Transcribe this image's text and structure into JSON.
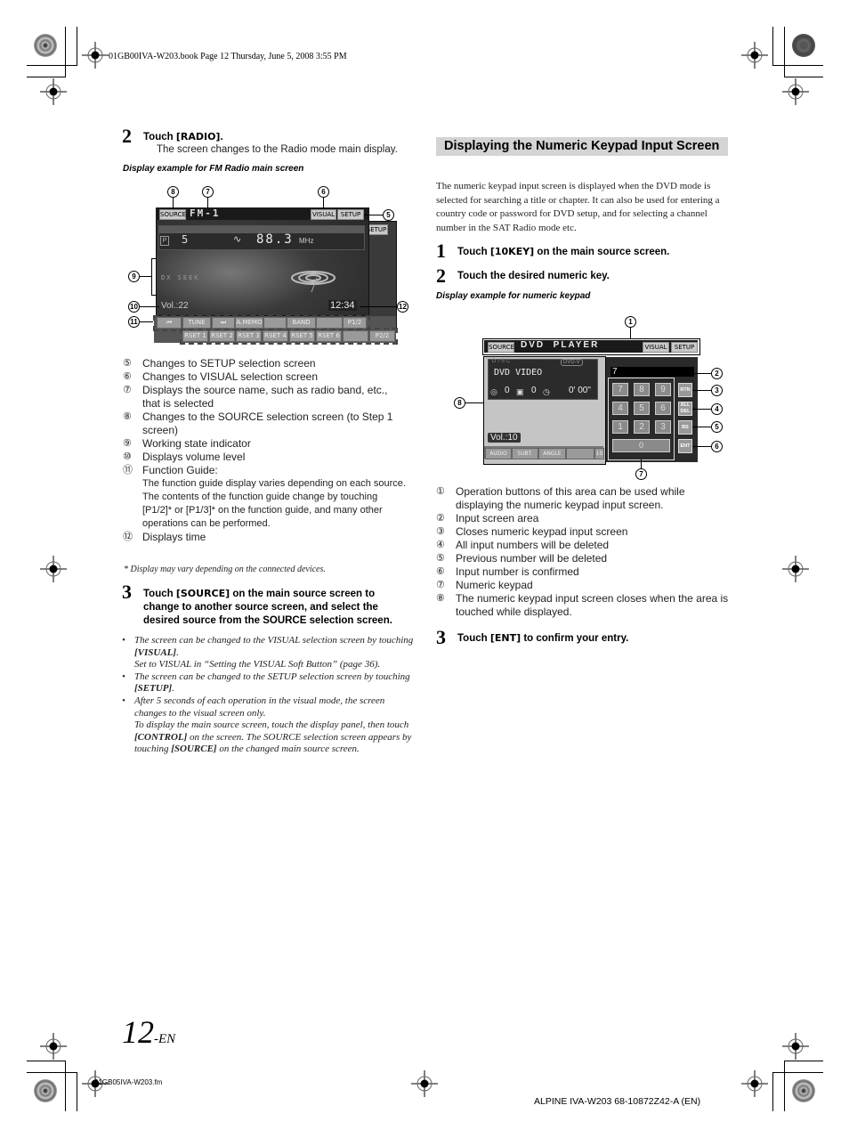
{
  "print_header": "01GB00IVA-W203.book  Page 12  Thursday, June 5, 2008  3:55 PM",
  "left": {
    "step2": {
      "number": "2",
      "title_prefix": "Touch ",
      "title_kw": "[RADIO]",
      "title_suffix": ".",
      "sub": "The screen changes to the Radio mode main display."
    },
    "fm_caption": "Display example for FM Radio main screen",
    "fm_screen": {
      "source_btn": "SOURCE",
      "band_name": "FM-1",
      "visual_btn": "VISUAL",
      "setup_btn": "SETUP",
      "setup_btn_back": "SETUP",
      "preset_icon": "P",
      "preset_num": "5",
      "st_icon": "∿",
      "frequency": "88.3",
      "unit": "MHz",
      "state": "DX SEEK",
      "volume": "Vol.:22",
      "time": "12:34",
      "time_back": "34",
      "guide_row1": [
        "⏮",
        "TUNE",
        "⏭",
        "A.MEMO",
        "",
        "BAND",
        "",
        "P1/2"
      ],
      "guide_row2": [
        "RSET 1",
        "RSET 2",
        "RSET 3",
        "RSET 4",
        "RSET 5",
        "RSET 6",
        "",
        "P2/2"
      ],
      "callouts": {
        "c5": "5",
        "c6": "6",
        "c7": "7",
        "c8": "8",
        "c9": "9",
        "c10": "10",
        "c11": "11",
        "c12": "12"
      }
    },
    "legend": [
      {
        "num": "⑤",
        "text": "Changes to SETUP selection screen"
      },
      {
        "num": "⑥",
        "text": "Changes to VISUAL selection screen"
      },
      {
        "num": "⑦",
        "text": "Displays the source name, such as radio band, etc., that is selected"
      },
      {
        "num": "⑧",
        "text": "Changes to the SOURCE selection screen (to Step 1 screen)"
      },
      {
        "num": "⑨",
        "text": "Working state indicator"
      },
      {
        "num": "⑩",
        "text": "Displays volume level"
      },
      {
        "num": "⑪",
        "text": "Function Guide:"
      },
      {
        "num": "",
        "text": "The function guide display varies depending on each source."
      },
      {
        "num": "",
        "text": "The contents of the function guide change by touching [P1/2]* or [P1/3]* on the function guide, and many other operations can be performed."
      },
      {
        "num": "⑫",
        "text": "Displays time"
      }
    ],
    "footnote": "*  Display may vary depending on the connected devices.",
    "step3": {
      "number": "3",
      "title_prefix": "Touch ",
      "title_kw": "[SOURCE]",
      "title_suffix": " on the main source screen to change to another source screen, and select the desired source from the SOURCE selection screen."
    },
    "notes": [
      {
        "a": "The screen can be changed to the VISUAL selection screen by touching ",
        "b": "[VISUAL]",
        "c": ".",
        "d": "Set to VISUAL in “Setting the VISUAL Soft Button” (page 36).",
        "e": "",
        "f": "",
        "g": ""
      },
      {
        "a": "The screen can be changed to the SETUP selection screen by touching ",
        "b": "[SETUP]",
        "c": ".",
        "d": "",
        "e": "",
        "f": "",
        "g": ""
      },
      {
        "a": "After 5 seconds of each operation in the visual mode, the screen changes to the visual screen only.",
        "b": "",
        "c": "",
        "d": "To display the main source screen, touch the display panel, then touch ",
        "e": "[CONTROL]",
        "f": " on the screen. The SOURCE selection screen appears by touching ",
        "g": "[SOURCE]",
        "h": " on the changed main source screen."
      }
    ]
  },
  "right": {
    "section_title": "Displaying the Numeric Keypad Input Screen",
    "intro": "The numeric keypad input screen is displayed when the DVD mode is selected for searching a title or chapter. It can also be used for entering a country code or password for DVD setup, and for selecting a channel number in the SAT Radio mode etc.",
    "step1": {
      "number": "1",
      "title_prefix": "Touch ",
      "title_kw": "[10KEY]",
      "title_suffix": " on the main source screen."
    },
    "step2": {
      "number": "2",
      "title": "Touch the desired numeric key."
    },
    "keypad_caption": "Display example for numeric keypad",
    "dvd_screen": {
      "source_btn": "SOURCE",
      "title": "DVD  PLAYER",
      "visual_btn": "VISUAL",
      "setup_btn": "SETUP",
      "disc_label": "DISC",
      "disc_type": "DVD-V",
      "disc_name": "DVD VIDEO",
      "title_num": "0",
      "chapter_num": "0",
      "elapsed": "0' 00\"",
      "volume": "Vol.:10",
      "guide": [
        "AUDIO",
        "SUBT.",
        "ANGLE",
        "",
        "10"
      ],
      "input_value": "7",
      "keys": [
        "7",
        "8",
        "9",
        "4",
        "5",
        "6",
        "1",
        "2",
        "3"
      ],
      "zero_key": "0",
      "side_keys": [
        "RTN",
        "ALL DEL",
        "BS",
        "ENT"
      ],
      "callouts": {
        "c1": "1",
        "c2": "2",
        "c3": "3",
        "c4": "4",
        "c5": "5",
        "c6": "6",
        "c7": "7",
        "c8": "8"
      }
    },
    "legend": [
      {
        "num": "①",
        "text": "Operation buttons of this area can be used while displaying the numeric keypad input screen."
      },
      {
        "num": "②",
        "text": "Input screen area"
      },
      {
        "num": "③",
        "text": "Closes numeric keypad input screen"
      },
      {
        "num": "④",
        "text": "All input numbers will be deleted"
      },
      {
        "num": "⑤",
        "text": "Previous number will be deleted"
      },
      {
        "num": "⑥",
        "text": "Input number is confirmed"
      },
      {
        "num": "⑦",
        "text": "Numeric keypad"
      },
      {
        "num": "⑧",
        "text": "The numeric keypad input screen closes when the area is touched while displayed."
      }
    ],
    "step3": {
      "number": "3",
      "title_prefix": "Touch ",
      "title_kw": "[ENT]",
      "title_suffix": " to confirm your entry."
    }
  },
  "page_number": "12",
  "page_suffix": "-EN",
  "file_name": "01GB05IVA-W203.fm",
  "footer_code": "ALPINE IVA-W203 68-10872Z42-A (EN)"
}
